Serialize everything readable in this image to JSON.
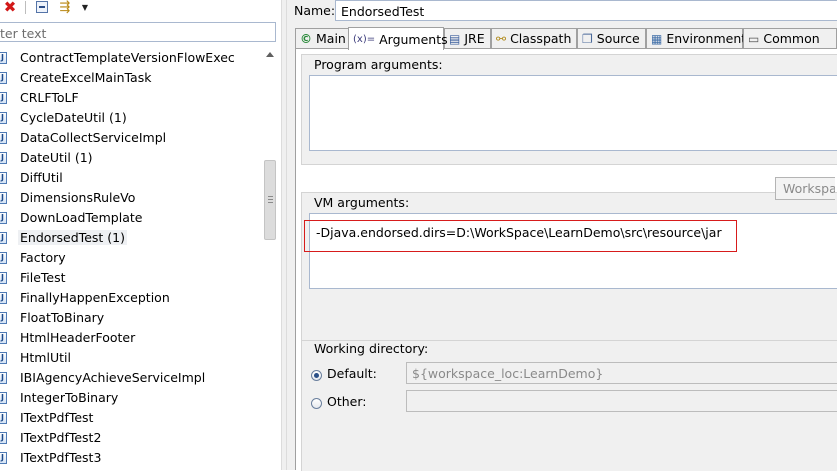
{
  "left_toolbar": {
    "delete_icon": "red-x-icon",
    "collapse_icon": "collapse-all-icon",
    "filter_icon": "filter-icon",
    "menu_icon": "view-menu-icon"
  },
  "filter": {
    "text": "ter text"
  },
  "config_list": [
    {
      "label": "ContractTemplateVersionFlowExec"
    },
    {
      "label": "CreateExcelMainTask"
    },
    {
      "label": "CRLFToLF"
    },
    {
      "label": "CycleDateUtil (1)"
    },
    {
      "label": "DataCollectServiceImpl"
    },
    {
      "label": "DateUtil (1)"
    },
    {
      "label": "DiffUtil"
    },
    {
      "label": "DimensionsRuleVo"
    },
    {
      "label": "DownLoadTemplate"
    },
    {
      "label": "EndorsedTest (1)",
      "selected": true
    },
    {
      "label": "Factory"
    },
    {
      "label": "FileTest"
    },
    {
      "label": "FinallyHappenException"
    },
    {
      "label": "FloatToBinary"
    },
    {
      "label": "HtmlHeaderFooter"
    },
    {
      "label": "HtmlUtil"
    },
    {
      "label": "IBIAgencyAchieveServiceImpl"
    },
    {
      "label": "IntegerToBinary"
    },
    {
      "label": "ITextPdfTest"
    },
    {
      "label": "ITextPdfTest2"
    },
    {
      "label": "ITextPdfTest3"
    }
  ],
  "name": {
    "label": "Name:",
    "value": "EndorsedTest"
  },
  "tabs": [
    {
      "label": "Main",
      "icon": "main-icon"
    },
    {
      "label": "Arguments",
      "icon": "arguments-icon",
      "active": true
    },
    {
      "label": "JRE",
      "icon": "jre-icon"
    },
    {
      "label": "Classpath",
      "icon": "classpath-icon"
    },
    {
      "label": "Source",
      "icon": "source-icon"
    },
    {
      "label": "Environment",
      "icon": "environment-icon"
    },
    {
      "label": "Common",
      "icon": "common-icon"
    }
  ],
  "program_arguments": {
    "label": "Program arguments:",
    "value": ""
  },
  "vm_arguments": {
    "label": "VM arguments:",
    "value": "-Djava.endorsed.dirs=D:\\WorkSpace\\LearnDemo\\src\\resource\\jar"
  },
  "working_directory": {
    "label": "Working directory:",
    "default_label": "Default:",
    "default_value": "${workspace_loc:LearnDemo}",
    "other_label": "Other:",
    "other_value": "",
    "selected": "Default",
    "workspace_button": "Workspa"
  },
  "colors": {
    "highlight_box": "#d71b1b",
    "selection_bg": "#eef0f3"
  }
}
